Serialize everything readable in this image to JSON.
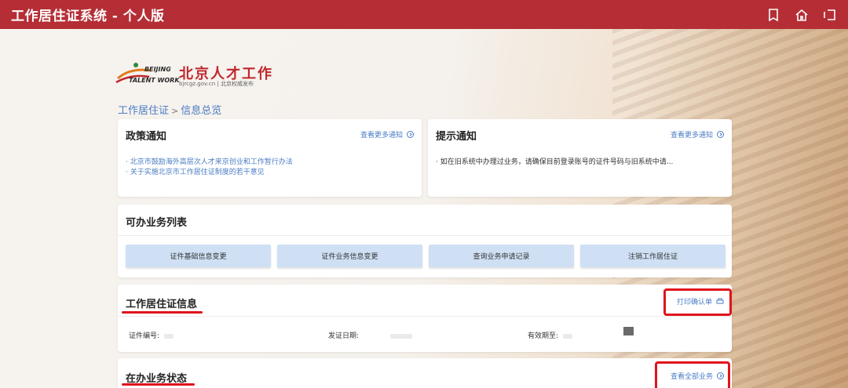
{
  "app": {
    "title": "工作居住证系统 - 个人版",
    "icons": [
      "bookmark-icon",
      "home-icon",
      "logout-icon"
    ]
  },
  "logo": {
    "en_line1": "BEIJING",
    "en_line2": "TALENT WORK",
    "cn": "北京人才工作",
    "url": "bjrcgz.gov.cn | 北京权威发布"
  },
  "breadcrumb": {
    "root": "工作居住证",
    "sep": ">",
    "current": "信息总览"
  },
  "policy_notice": {
    "title": "政策通知",
    "more_label": "查看更多通知",
    "items": [
      "· 北京市鼓励海外高层次人才来京创业和工作暂行办法",
      "· 关于实施北京市工作居住证制度的若干意见"
    ]
  },
  "tip_notice": {
    "title": "提示通知",
    "more_label": "查看更多通知",
    "items": [
      "· 如在旧系统中办理过业务，请确保目前登录账号的证件号码与旧系统中请..."
    ]
  },
  "services": {
    "title": "可办业务列表",
    "buttons": [
      "证件基础信息变更",
      "证件业务信息变更",
      "查询业务申请记录",
      "注销工作居住证"
    ]
  },
  "permit_info": {
    "title": "工作居住证信息",
    "print_label": "打印确认单",
    "fields": [
      {
        "label": "证件编号:"
      },
      {
        "label": "发证日期:"
      },
      {
        "label": "有效期至:"
      }
    ]
  },
  "business_status": {
    "title": "在办业务状态",
    "view_all_label": "查看全部业务"
  },
  "colors": {
    "topbar": "#b52e35",
    "link": "#4a7cc4",
    "service_button": "#cfe0f5",
    "annotation_red": "#e0141c"
  }
}
